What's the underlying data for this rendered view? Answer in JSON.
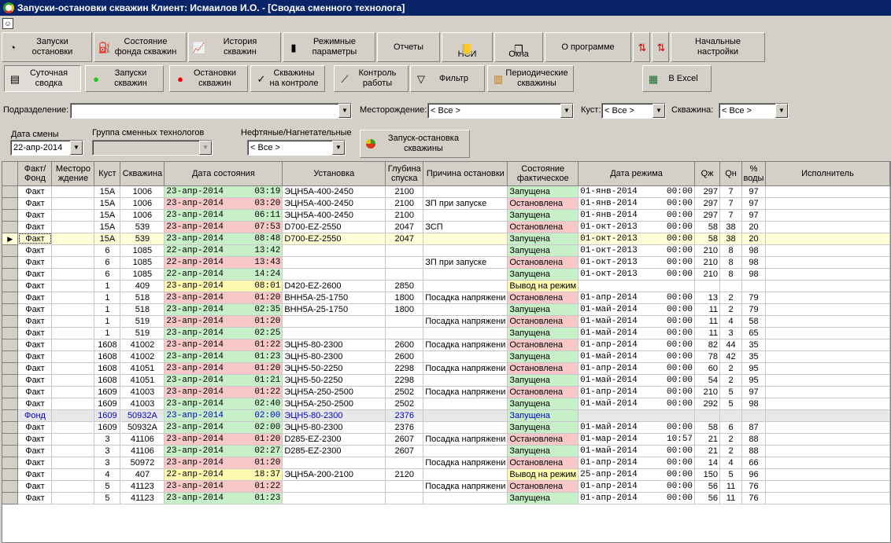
{
  "window_title": "Запуски-остановки скважин  Клиент: Исмаилов И.О. - [Сводка сменного технолога]",
  "toolbar1": [
    {
      "label": "Запуски\nостановки",
      "icon": "start-stop-icon"
    },
    {
      "label": "Состояние\nфонда скважин",
      "icon": "pump-icon"
    },
    {
      "label": "История\nскважин",
      "icon": "history-chart-icon"
    },
    {
      "label": "Режимные\nпараметры",
      "icon": "bars-chart-icon"
    },
    {
      "label": "Отчеты",
      "icon": ""
    },
    {
      "label": "НСИ",
      "icon": "book-icon"
    },
    {
      "label": "Окна",
      "icon": "windows-icon"
    },
    {
      "label": "О программе",
      "icon": ""
    },
    {
      "label": "",
      "icon": "sort-az-icon"
    },
    {
      "label": "",
      "icon": "sort-za-icon"
    },
    {
      "label": "Начальные\nнастройки",
      "icon": ""
    }
  ],
  "toolbar2": [
    {
      "label": "Суточная\nсводка",
      "icon": "report-icon"
    },
    {
      "label": "Запуски\nскважин",
      "icon": "green-dot-icon"
    },
    {
      "label": "Остановки\nскважин",
      "icon": "red-dot-icon"
    },
    {
      "label": "Скважины\nна контроле",
      "icon": "control-icon"
    },
    {
      "label": "Контроль\nработы",
      "icon": "line-chart-icon"
    },
    {
      "label": "Фильтр",
      "icon": "filter-icon"
    },
    {
      "label": "Периодические\nскважины",
      "icon": "periodic-icon"
    },
    {
      "label": "В Excel",
      "icon": "excel-icon"
    }
  ],
  "filters": {
    "subdivision_label": "Подразделение:",
    "subdivision_value": "",
    "field_label": "Месторождение:",
    "field_value": "< Все >",
    "bush_label": "Куст:",
    "bush_value": "< Все >",
    "well_label": "Скважина:",
    "well_value": "< Все >",
    "shift_date_label": "Дата смены",
    "shift_date_value": "22-апр-2014",
    "group_label": "Группа сменных технологов",
    "group_value": "",
    "oil_label": "Нефтяные/Нагнетательные",
    "oil_value": "< Все >",
    "launch_button": "Запуск-остановка\nскважины"
  },
  "columns": [
    "Факт/\nФонд",
    "Месторо\nждение",
    "Куст",
    "Скважина",
    "Дата состояния",
    "Установка",
    "Глубина\nспуска",
    "Причина остановки",
    "Состояние\nфактическое",
    "Дата режима",
    "Qж",
    "Qн",
    "%\nводы",
    "Исполнитель"
  ],
  "rows": [
    {
      "ff": "Факт",
      "m": "",
      "kust": "15А",
      "well": "1006",
      "date": "23-апр-2014",
      "time": "03:19",
      "dcol": "g",
      "ust": "ЭЦН5А-400-2450",
      "depth": "2100",
      "reason": "",
      "state": "Запущена",
      "scol": "g",
      "rdate": "01-янв-2014",
      "rtime": "00:00",
      "qj": "297",
      "qn": "7",
      "w": "97"
    },
    {
      "ff": "Факт",
      "m": "",
      "kust": "15А",
      "well": "1006",
      "date": "23-апр-2014",
      "time": "03:20",
      "dcol": "p",
      "ust": "ЭЦН5А-400-2450",
      "depth": "2100",
      "reason": "ЗП при запуске",
      "state": "Остановлена",
      "scol": "p",
      "rdate": "01-янв-2014",
      "rtime": "00:00",
      "qj": "297",
      "qn": "7",
      "w": "97"
    },
    {
      "ff": "Факт",
      "m": "",
      "kust": "15А",
      "well": "1006",
      "date": "23-апр-2014",
      "time": "06:11",
      "dcol": "g",
      "ust": "ЭЦН5А-400-2450",
      "depth": "2100",
      "reason": "",
      "state": "Запущена",
      "scol": "g",
      "rdate": "01-янв-2014",
      "rtime": "00:00",
      "qj": "297",
      "qn": "7",
      "w": "97"
    },
    {
      "ff": "Факт",
      "m": "",
      "kust": "15А",
      "well": "539",
      "date": "23-апр-2014",
      "time": "07:53",
      "dcol": "p",
      "ust": "D700-EZ-2550",
      "depth": "2047",
      "reason": "ЗСП",
      "state": "Остановлена",
      "scol": "p",
      "rdate": "01-окт-2013",
      "rtime": "00:00",
      "qj": "58",
      "qn": "38",
      "w": "20"
    },
    {
      "ff": "Факт",
      "m": "",
      "kust": "15А",
      "well": "539",
      "date": "23-апр-2014",
      "time": "08:48",
      "dcol": "g",
      "ust": "D700-EZ-2550",
      "depth": "2047",
      "reason": "",
      "state": "Запущена",
      "scol": "g",
      "rdate": "01-окт-2013",
      "rtime": "00:00",
      "qj": "58",
      "qn": "38",
      "w": "20",
      "sel": true
    },
    {
      "ff": "Факт",
      "m": "",
      "kust": "6",
      "well": "1085",
      "date": "22-апр-2014",
      "time": "13:42",
      "dcol": "g",
      "ust": "",
      "depth": "",
      "reason": "",
      "state": "Запущена",
      "scol": "g",
      "rdate": "01-окт-2013",
      "rtime": "00:00",
      "qj": "210",
      "qn": "8",
      "w": "98"
    },
    {
      "ff": "Факт",
      "m": "",
      "kust": "6",
      "well": "1085",
      "date": "22-апр-2014",
      "time": "13:43",
      "dcol": "p",
      "ust": "",
      "depth": "",
      "reason": "ЗП при запуске",
      "state": "Остановлена",
      "scol": "p",
      "rdate": "01-окт-2013",
      "rtime": "00:00",
      "qj": "210",
      "qn": "8",
      "w": "98"
    },
    {
      "ff": "Факт",
      "m": "",
      "kust": "6",
      "well": "1085",
      "date": "22-апр-2014",
      "time": "14:24",
      "dcol": "g",
      "ust": "",
      "depth": "",
      "reason": "",
      "state": "Запущена",
      "scol": "g",
      "rdate": "01-окт-2013",
      "rtime": "00:00",
      "qj": "210",
      "qn": "8",
      "w": "98"
    },
    {
      "ff": "Факт",
      "m": "",
      "kust": "1",
      "well": "409",
      "date": "23-апр-2014",
      "time": "08:01",
      "dcol": "y",
      "ust": "D420-EZ-2600",
      "depth": "2850",
      "reason": "",
      "state": "Вывод на режим",
      "scol": "y",
      "rdate": "",
      "rtime": "",
      "qj": "",
      "qn": "",
      "w": ""
    },
    {
      "ff": "Факт",
      "m": "",
      "kust": "1",
      "well": "518",
      "date": "23-апр-2014",
      "time": "01:20",
      "dcol": "p",
      "ust": "ВНН5А-25-1750",
      "depth": "1800",
      "reason": "Посадка напряжени",
      "state": "Остановлена",
      "scol": "p",
      "rdate": "01-апр-2014",
      "rtime": "00:00",
      "qj": "13",
      "qn": "2",
      "w": "79"
    },
    {
      "ff": "Факт",
      "m": "",
      "kust": "1",
      "well": "518",
      "date": "23-апр-2014",
      "time": "02:35",
      "dcol": "g",
      "ust": "ВНН5А-25-1750",
      "depth": "1800",
      "reason": "",
      "state": "Запущена",
      "scol": "g",
      "rdate": "01-май-2014",
      "rtime": "00:00",
      "qj": "11",
      "qn": "2",
      "w": "79"
    },
    {
      "ff": "Факт",
      "m": "",
      "kust": "1",
      "well": "519",
      "date": "23-апр-2014",
      "time": "01:20",
      "dcol": "p",
      "ust": "",
      "depth": "",
      "reason": "Посадка напряжени",
      "state": "Остановлена",
      "scol": "p",
      "rdate": "01-май-2014",
      "rtime": "00:00",
      "qj": "11",
      "qn": "4",
      "w": "58"
    },
    {
      "ff": "Факт",
      "m": "",
      "kust": "1",
      "well": "519",
      "date": "23-апр-2014",
      "time": "02:25",
      "dcol": "g",
      "ust": "",
      "depth": "",
      "reason": "",
      "state": "Запущена",
      "scol": "g",
      "rdate": "01-май-2014",
      "rtime": "00:00",
      "qj": "11",
      "qn": "3",
      "w": "65"
    },
    {
      "ff": "Факт",
      "m": "",
      "kust": "1608",
      "well": "41002",
      "date": "23-апр-2014",
      "time": "01:22",
      "dcol": "p",
      "ust": "ЭЦН5-80-2300",
      "depth": "2600",
      "reason": "Посадка напряжени",
      "state": "Остановлена",
      "scol": "p",
      "rdate": "01-апр-2014",
      "rtime": "00:00",
      "qj": "82",
      "qn": "44",
      "w": "35"
    },
    {
      "ff": "Факт",
      "m": "",
      "kust": "1608",
      "well": "41002",
      "date": "23-апр-2014",
      "time": "01:23",
      "dcol": "g",
      "ust": "ЭЦН5-80-2300",
      "depth": "2600",
      "reason": "",
      "state": "Запущена",
      "scol": "g",
      "rdate": "01-май-2014",
      "rtime": "00:00",
      "qj": "78",
      "qn": "42",
      "w": "35"
    },
    {
      "ff": "Факт",
      "m": "",
      "kust": "1608",
      "well": "41051",
      "date": "23-апр-2014",
      "time": "01:20",
      "dcol": "p",
      "ust": "ЭЦН5-50-2250",
      "depth": "2298",
      "reason": "Посадка напряжени",
      "state": "Остановлена",
      "scol": "p",
      "rdate": "01-апр-2014",
      "rtime": "00:00",
      "qj": "60",
      "qn": "2",
      "w": "95"
    },
    {
      "ff": "Факт",
      "m": "",
      "kust": "1608",
      "well": "41051",
      "date": "23-апр-2014",
      "time": "01:21",
      "dcol": "g",
      "ust": "ЭЦН5-50-2250",
      "depth": "2298",
      "reason": "",
      "state": "Запущена",
      "scol": "g",
      "rdate": "01-май-2014",
      "rtime": "00:00",
      "qj": "54",
      "qn": "2",
      "w": "95"
    },
    {
      "ff": "Факт",
      "m": "",
      "kust": "1609",
      "well": "41003",
      "date": "23-апр-2014",
      "time": "01:22",
      "dcol": "p",
      "ust": "ЭЦН5А-250-2500",
      "depth": "2502",
      "reason": "Посадка напряжени",
      "state": "Остановлена",
      "scol": "p",
      "rdate": "01-апр-2014",
      "rtime": "00:00",
      "qj": "210",
      "qn": "5",
      "w": "97"
    },
    {
      "ff": "Факт",
      "m": "",
      "kust": "1609",
      "well": "41003",
      "date": "23-апр-2014",
      "time": "02:40",
      "dcol": "g",
      "ust": "ЭЦН5А-250-2500",
      "depth": "2502",
      "reason": "",
      "state": "Запущена",
      "scol": "g",
      "rdate": "01-май-2014",
      "rtime": "00:00",
      "qj": "292",
      "qn": "5",
      "w": "98"
    },
    {
      "ff": "Фонд",
      "m": "",
      "kust": "1609",
      "well": "50932А",
      "date": "23-апр-2014",
      "time": "02:00",
      "dcol": "g",
      "ust": "ЭЦН5-80-2300",
      "depth": "2376",
      "reason": "",
      "state": "Запущена",
      "scol": "g",
      "rdate": "",
      "rtime": "",
      "qj": "",
      "qn": "",
      "w": "",
      "fond": true
    },
    {
      "ff": "Факт",
      "m": "",
      "kust": "1609",
      "well": "50932А",
      "date": "23-апр-2014",
      "time": "02:00",
      "dcol": "g",
      "ust": "ЭЦН5-80-2300",
      "depth": "2376",
      "reason": "",
      "state": "Запущена",
      "scol": "g",
      "rdate": "01-май-2014",
      "rtime": "00:00",
      "qj": "58",
      "qn": "6",
      "w": "87"
    },
    {
      "ff": "Факт",
      "m": "",
      "kust": "3",
      "well": "41106",
      "date": "23-апр-2014",
      "time": "01:20",
      "dcol": "p",
      "ust": "D285-EZ-2300",
      "depth": "2607",
      "reason": "Посадка напряжени",
      "state": "Остановлена",
      "scol": "p",
      "rdate": "01-мар-2014",
      "rtime": "10:57",
      "qj": "21",
      "qn": "2",
      "w": "88"
    },
    {
      "ff": "Факт",
      "m": "",
      "kust": "3",
      "well": "41106",
      "date": "23-апр-2014",
      "time": "02:27",
      "dcol": "g",
      "ust": "D285-EZ-2300",
      "depth": "2607",
      "reason": "",
      "state": "Запущена",
      "scol": "g",
      "rdate": "01-май-2014",
      "rtime": "00:00",
      "qj": "21",
      "qn": "2",
      "w": "88"
    },
    {
      "ff": "Факт",
      "m": "",
      "kust": "3",
      "well": "50972",
      "date": "23-апр-2014",
      "time": "01:20",
      "dcol": "p",
      "ust": "",
      "depth": "",
      "reason": "Посадка напряжени",
      "state": "Остановлена",
      "scol": "p",
      "rdate": "01-апр-2014",
      "rtime": "00:00",
      "qj": "14",
      "qn": "4",
      "w": "66"
    },
    {
      "ff": "Факт",
      "m": "",
      "kust": "4",
      "well": "407",
      "date": "22-апр-2014",
      "time": "18:37",
      "dcol": "y",
      "ust": "ЭЦН5А-200-2100",
      "depth": "2120",
      "reason": "",
      "state": "Вывод на режим",
      "scol": "y",
      "rdate": "25-апр-2014",
      "rtime": "00:00",
      "qj": "150",
      "qn": "5",
      "w": "96"
    },
    {
      "ff": "Факт",
      "m": "",
      "kust": "5",
      "well": "41123",
      "date": "23-апр-2014",
      "time": "01:22",
      "dcol": "p",
      "ust": "",
      "depth": "",
      "reason": "Посадка напряжени",
      "state": "Остановлена",
      "scol": "p",
      "rdate": "01-апр-2014",
      "rtime": "00:00",
      "qj": "56",
      "qn": "11",
      "w": "76"
    },
    {
      "ff": "Факт",
      "m": "",
      "kust": "5",
      "well": "41123",
      "date": "23-апр-2014",
      "time": "01:23",
      "dcol": "g",
      "ust": "",
      "depth": "",
      "reason": "",
      "state": "Запущена",
      "scol": "g",
      "rdate": "01-апр-2014",
      "rtime": "00:00",
      "qj": "56",
      "qn": "11",
      "w": "76"
    }
  ]
}
